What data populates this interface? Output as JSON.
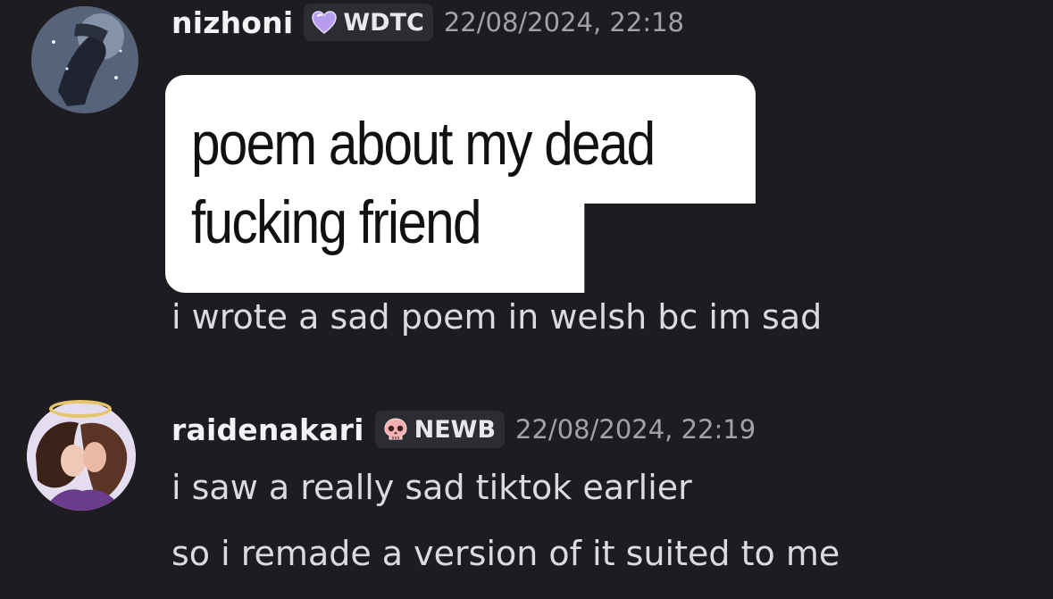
{
  "messages": [
    {
      "username": "nizhoni",
      "badge": {
        "label": "WDTC",
        "icon": "purple-heart-icon",
        "color": "#b89cf0"
      },
      "timestamp": "22/08/2024, 22:18",
      "overlay_caption": "poem about my dead\nfucking friend",
      "lines": [
        "i wrote a sad poem in welsh bc im sad"
      ]
    },
    {
      "username": "raidenakari",
      "badge": {
        "label": "NEWB",
        "icon": "skull-icon",
        "color": "#f0a0a0"
      },
      "timestamp": "22/08/2024, 22:19",
      "lines": [
        "i saw a really sad tiktok earlier",
        "so i remade a version of it suited to me"
      ]
    }
  ]
}
